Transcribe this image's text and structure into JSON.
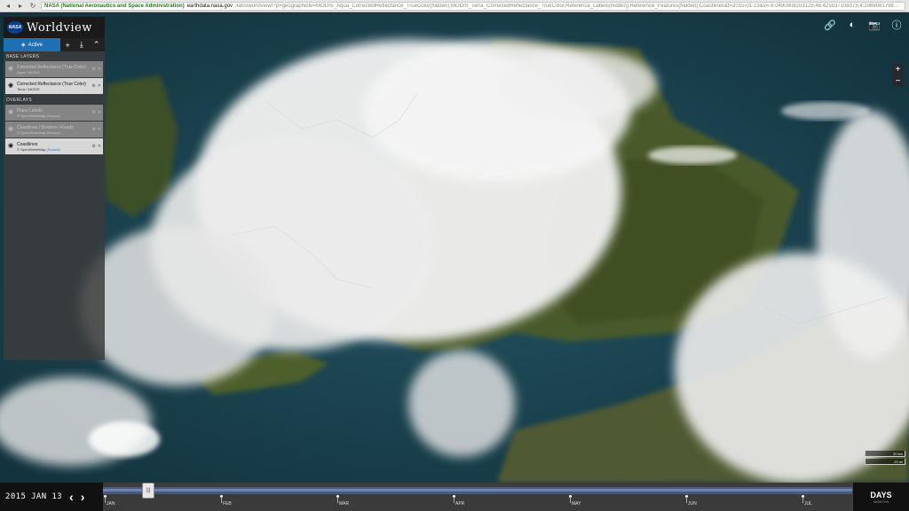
{
  "browser": {
    "secure_label": "NASA (National Aeronautics and Space Administration)",
    "url_host": "earthdata.nasa.gov",
    "url_path": "/labs/worldview/?p=geographic&l=MODIS_Aqua_CorrectedReflectance_TrueColor(hidden),MODIS_Terra_CorrectedReflectance_TrueColor,Reference_Labels(hidden),Reference_Features(hidden),Coastlines&t=2015-01-13&v=-8.0490908203125,48.425537109375,4.298808179875,54.377880859375 - GOOG"
  },
  "app": {
    "logo_text": "NASA",
    "title": "Worldview"
  },
  "tabs": {
    "active_label": "Active",
    "add_icon": "+",
    "download_icon": "⤓",
    "collapse_icon": "⌃"
  },
  "sections": {
    "base_layers": "Base Layers",
    "overlays": "Overlays"
  },
  "base_layers": [
    {
      "title": "Corrected Reflectance (True Color)",
      "subtitle": "Aqua / MODIS",
      "visible": false
    },
    {
      "title": "Corrected Reflectance (True Color)",
      "subtitle": "Terra / MODIS",
      "visible": true
    }
  ],
  "overlays": [
    {
      "title": "Place Labels",
      "subtitle": "© OpenStreetMap (Source)",
      "visible": false
    },
    {
      "title": "Coastlines / Borders / Roads",
      "subtitle": "© OpenStreetMap (Source)",
      "visible": false
    },
    {
      "title": "Coastlines",
      "subtitle": "© OpenStreetMap",
      "link": "(Source)",
      "visible": true
    }
  ],
  "top_tools": [
    {
      "name": "link-icon",
      "glyph": "🔗"
    },
    {
      "name": "globe-icon",
      "glyph": "◐"
    },
    {
      "name": "camera-icon",
      "glyph": "📷"
    },
    {
      "name": "info-icon",
      "glyph": "ⓘ"
    }
  ],
  "zoom": {
    "in": "+",
    "out": "−"
  },
  "scale": {
    "km": "20 km",
    "mi": "20 mi"
  },
  "timeline": {
    "date": "2015 JAN 13",
    "prev": "‹",
    "next": "›",
    "months": [
      "JAN",
      "FEB",
      "MAR",
      "APR",
      "MAY",
      "JUN",
      "JUL"
    ],
    "zoom_main": "DAYS",
    "zoom_sub": "MONTHS"
  },
  "colors": {
    "accent": "#1f6fb5",
    "sea": "#1d4451",
    "land": "#4a5a2a",
    "cloud": "#f2f2f2"
  }
}
